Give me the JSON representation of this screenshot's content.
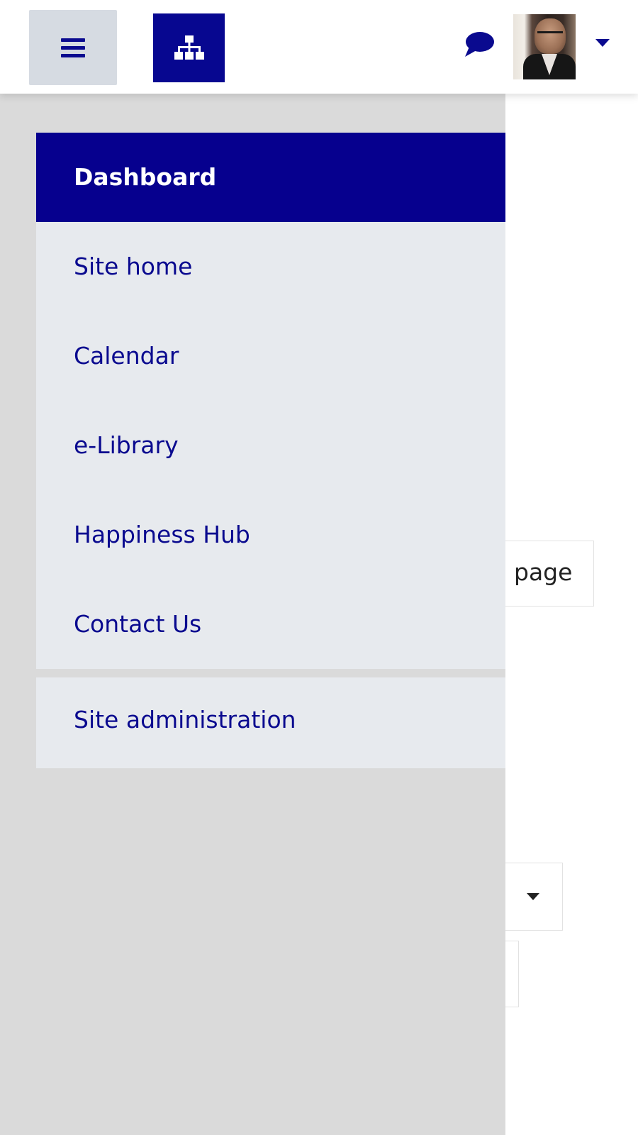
{
  "header": {
    "menu_icon": "hamburger-icon",
    "sitemap_icon": "sitemap-icon",
    "messages_icon": "chat-bubble-icon",
    "user_menu_icon": "caret-down-icon",
    "accent_color": "#06008e"
  },
  "drawer": {
    "items": [
      {
        "label": "Dashboard",
        "active": true
      },
      {
        "label": "Site home"
      },
      {
        "label": "Calendar"
      },
      {
        "label": "e-Library"
      },
      {
        "label": "Happiness Hub"
      },
      {
        "label": "Contact Us"
      }
    ],
    "admin_item": {
      "label": "Site administration"
    }
  },
  "background": {
    "page_button_text": "page",
    "select_visible_text": ")"
  }
}
